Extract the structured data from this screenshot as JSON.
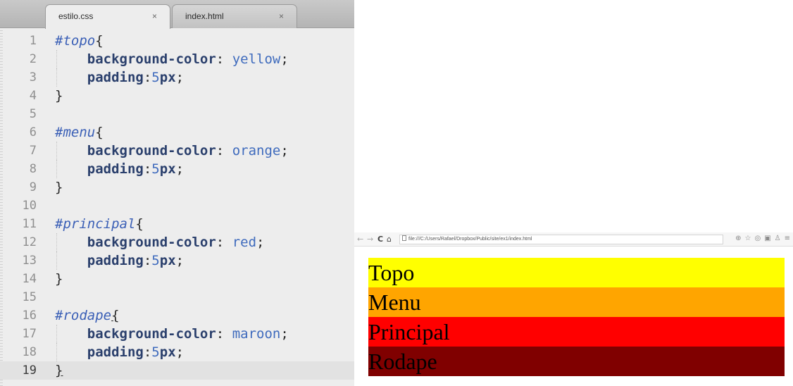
{
  "editor": {
    "tabs": [
      {
        "label": "estilo.css",
        "close": "×",
        "active": true
      },
      {
        "label": "index.html",
        "close": "×",
        "active": false
      }
    ],
    "current_line": 19,
    "lines": [
      {
        "num": "1",
        "tokens": [
          [
            "sel",
            "#topo"
          ],
          [
            "brace",
            "{"
          ]
        ]
      },
      {
        "num": "2",
        "tokens": [
          [
            "indent",
            "    "
          ],
          [
            "prop",
            "background-color"
          ],
          [
            "colon",
            ": "
          ],
          [
            "val",
            "yellow"
          ],
          [
            "colon",
            ";"
          ]
        ]
      },
      {
        "num": "3",
        "tokens": [
          [
            "indent",
            "    "
          ],
          [
            "prop",
            "padding"
          ],
          [
            "colon",
            ":"
          ],
          [
            "num",
            "5"
          ],
          [
            "unit",
            "px"
          ],
          [
            "colon",
            ";"
          ]
        ]
      },
      {
        "num": "4",
        "tokens": [
          [
            "brace",
            "}"
          ]
        ]
      },
      {
        "num": "5",
        "tokens": []
      },
      {
        "num": "6",
        "tokens": [
          [
            "sel",
            "#menu"
          ],
          [
            "brace",
            "{"
          ]
        ]
      },
      {
        "num": "7",
        "tokens": [
          [
            "indent",
            "    "
          ],
          [
            "prop",
            "background-color"
          ],
          [
            "colon",
            ": "
          ],
          [
            "val",
            "orange"
          ],
          [
            "colon",
            ";"
          ]
        ]
      },
      {
        "num": "8",
        "tokens": [
          [
            "indent",
            "    "
          ],
          [
            "prop",
            "padding"
          ],
          [
            "colon",
            ":"
          ],
          [
            "num",
            "5"
          ],
          [
            "unit",
            "px"
          ],
          [
            "colon",
            ";"
          ]
        ]
      },
      {
        "num": "9",
        "tokens": [
          [
            "brace",
            "}"
          ]
        ]
      },
      {
        "num": "10",
        "tokens": []
      },
      {
        "num": "11",
        "tokens": [
          [
            "sel",
            "#principal"
          ],
          [
            "brace",
            "{"
          ]
        ]
      },
      {
        "num": "12",
        "tokens": [
          [
            "indent",
            "    "
          ],
          [
            "prop",
            "background-color"
          ],
          [
            "colon",
            ": "
          ],
          [
            "val",
            "red"
          ],
          [
            "colon",
            ";"
          ]
        ]
      },
      {
        "num": "13",
        "tokens": [
          [
            "indent",
            "    "
          ],
          [
            "prop",
            "padding"
          ],
          [
            "colon",
            ":"
          ],
          [
            "num",
            "5"
          ],
          [
            "unit",
            "px"
          ],
          [
            "colon",
            ";"
          ]
        ]
      },
      {
        "num": "14",
        "tokens": [
          [
            "brace",
            "}"
          ]
        ]
      },
      {
        "num": "15",
        "tokens": []
      },
      {
        "num": "16",
        "tokens": [
          [
            "sel",
            "#rodape"
          ],
          [
            "brace_u",
            "{"
          ]
        ]
      },
      {
        "num": "17",
        "tokens": [
          [
            "indent",
            "    "
          ],
          [
            "prop",
            "background-color"
          ],
          [
            "colon",
            ": "
          ],
          [
            "val",
            "maroon"
          ],
          [
            "colon",
            ";"
          ]
        ]
      },
      {
        "num": "18",
        "tokens": [
          [
            "indent",
            "    "
          ],
          [
            "prop",
            "padding"
          ],
          [
            "colon",
            ":"
          ],
          [
            "num",
            "5"
          ],
          [
            "unit",
            "px"
          ],
          [
            "colon",
            ";"
          ]
        ]
      },
      {
        "num": "19",
        "tokens": [
          [
            "brace_u",
            "}"
          ]
        ]
      }
    ]
  },
  "browser": {
    "nav": {
      "back": "←",
      "forward": "→",
      "reload": "C",
      "home": "⌂"
    },
    "url": "file:///C:/Users/Rafael/Dropbox/Public/site/ex1/index.html",
    "toolbar_icons": [
      "zoom-icon",
      "star-icon",
      "extension-icon",
      "calendar-icon",
      "person-icon",
      "menu-icon"
    ],
    "toolbar_glyphs": [
      "⊕",
      "☆",
      "◎",
      "▣",
      "♙",
      "≡"
    ],
    "blocks": [
      {
        "id": "topo",
        "text": "Topo",
        "color": "#ffff00"
      },
      {
        "id": "menu",
        "text": "Menu",
        "color": "#ffa500"
      },
      {
        "id": "principal",
        "text": "Principal",
        "color": "#ff0000"
      },
      {
        "id": "rodape",
        "text": "Rodape",
        "color": "#800000"
      }
    ]
  }
}
